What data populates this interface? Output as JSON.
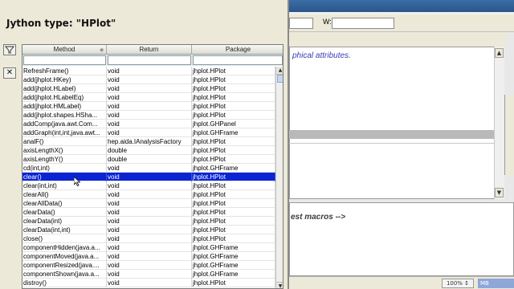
{
  "background": {
    "width_label": "W:",
    "editor_text_1": "phical attributes.",
    "editor_text_2": "est macros -->",
    "zoom": "100% ↕",
    "memory": "MB"
  },
  "dialog": {
    "title": "Jython type: \"HPlot\"",
    "filter_icon": "filter-icon",
    "close_icon": "close-icon",
    "table": {
      "columns": [
        "Method",
        "Return",
        "Package"
      ],
      "selected_index": 14,
      "rows": [
        [
          "RefreshFrame()",
          "void",
          "jhplot.HPlot"
        ],
        [
          "add(jhplot.HKey)",
          "void",
          "jhplot.HPlot"
        ],
        [
          "add(jhplot.HLabel)",
          "void",
          "jhplot.HPlot"
        ],
        [
          "add(jhplot.HLabelEq)",
          "void",
          "jhplot.HPlot"
        ],
        [
          "add(jhplot.HMLabel)",
          "void",
          "jhplot.HPlot"
        ],
        [
          "add(jhplot.shapes.HSha...",
          "void",
          "jhplot.HPlot"
        ],
        [
          "addComp(java.awt.Com...",
          "void",
          "jhplot.GHPanel"
        ],
        [
          "addGraph(int,int,java.awt...",
          "void",
          "jhplot.GHFrame"
        ],
        [
          "analF()",
          "hep.aida.IAnalysisFactory",
          "jhplot.HPlot"
        ],
        [
          "axisLengthX()",
          "double",
          "jhplot.HPlot"
        ],
        [
          "axisLengthY()",
          "double",
          "jhplot.HPlot"
        ],
        [
          "cd(int,int)",
          "void",
          "jhplot.GHFrame"
        ],
        [
          "clear()",
          "void",
          "jhplot.HPlot"
        ],
        [
          "clear(int,int)",
          "void",
          "jhplot.HPlot"
        ],
        [
          "clearAll()",
          "void",
          "jhplot.HPlot"
        ],
        [
          "clearAllData()",
          "void",
          "jhplot.HPlot"
        ],
        [
          "clearData()",
          "void",
          "jhplot.HPlot"
        ],
        [
          "clearData(int)",
          "void",
          "jhplot.HPlot"
        ],
        [
          "clearData(int,int)",
          "void",
          "jhplot.HPlot"
        ],
        [
          "close()",
          "void",
          "jhplot.HPlot"
        ],
        [
          "componentHidden(java.a...",
          "void",
          "jhplot.GHFrame"
        ],
        [
          "componentMoved(java.a...",
          "void",
          "jhplot.GHFrame"
        ],
        [
          "componentResized(java....",
          "void",
          "jhplot.GHFrame"
        ],
        [
          "componentShown(java.a...",
          "void",
          "jhplot.GHFrame"
        ],
        [
          "distroy()",
          "void",
          "jhplot.HPlot"
        ]
      ]
    }
  }
}
